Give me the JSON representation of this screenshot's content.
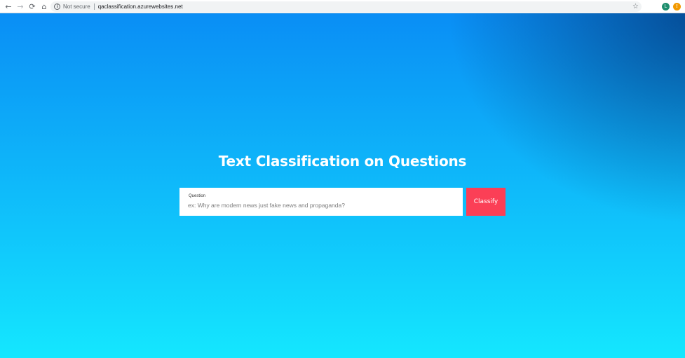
{
  "browser": {
    "nav": {
      "back_icon": "arrow-left-icon",
      "forward_icon": "arrow-right-icon",
      "reload_icon": "reload-icon",
      "home_icon": "home-icon"
    },
    "security_text": "Not secure",
    "url": "qaclassification.azurewebsites.net",
    "profile_initial": "L",
    "alert_glyph": "!"
  },
  "page": {
    "title": "Text Classification on Questions",
    "question_label": "Question",
    "question_placeholder": "ex: Why are modern news just fake news and propaganda?",
    "question_value": "",
    "classify_label": "Classify"
  },
  "colors": {
    "gradient_top": "#0a8ef5",
    "gradient_bottom": "#14e7fe",
    "button": "#fb3f56",
    "title": "#ffffff"
  }
}
